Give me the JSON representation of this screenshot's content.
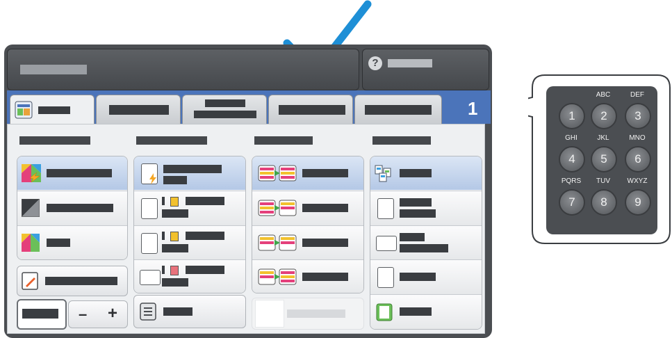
{
  "keypad": {
    "keys": [
      {
        "digit": "1",
        "letters": ""
      },
      {
        "digit": "2",
        "letters": "ABC"
      },
      {
        "digit": "3",
        "letters": "DEF"
      },
      {
        "digit": "4",
        "letters": "GHI"
      },
      {
        "digit": "5",
        "letters": "JKL"
      },
      {
        "digit": "6",
        "letters": "MNO"
      },
      {
        "digit": "7",
        "letters": "PQRS"
      },
      {
        "digit": "8",
        "letters": "TUV"
      },
      {
        "digit": "9",
        "letters": "WXYZ"
      }
    ]
  },
  "device": {
    "user_icon": "?",
    "badge": "1",
    "quantity": {
      "minus": "–",
      "plus": "+"
    }
  },
  "icons": [
    "checkmark-icon",
    "user-login-icon",
    "copy-app-icon",
    "color-auto-icon",
    "black-white-icon",
    "color-icon",
    "darkness-icon",
    "document-icon",
    "staple-icon",
    "two-sided-icon",
    "collate-icon",
    "orientation-icon",
    "paper-tray-icon"
  ],
  "colors": {
    "accent": "#4b74ba",
    "check": "#1e8fd6",
    "keypad": "#4b4e52"
  }
}
